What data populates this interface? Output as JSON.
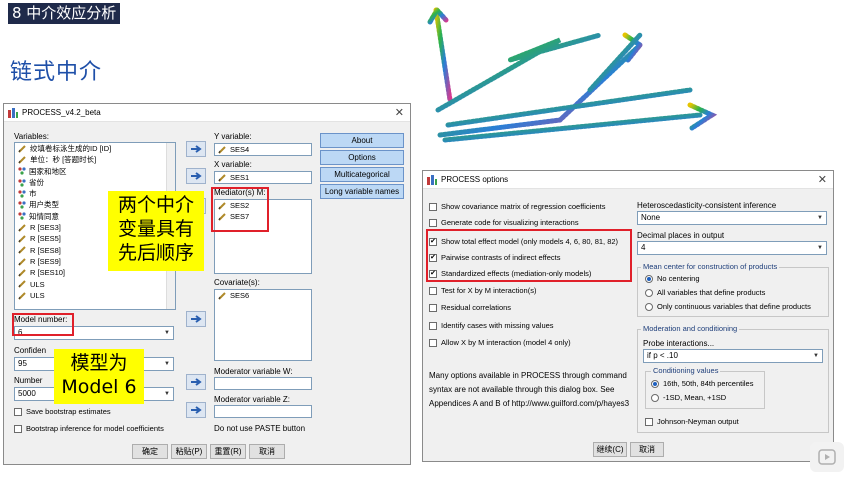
{
  "slide": {
    "tag": "8 中介效应分析",
    "title": "链式中介"
  },
  "process_dialog": {
    "title": "PROCESS_v4.2_beta",
    "variables_label": "Variables:",
    "variables": [
      {
        "name": "绞填卷标泳生成的ID [ID]",
        "type": "scale"
      },
      {
        "name": "单位：秒 [答题时长]",
        "type": "scale"
      },
      {
        "name": "国家和地区",
        "type": "nominal"
      },
      {
        "name": "省份",
        "type": "nominal"
      },
      {
        "name": "市",
        "type": "nominal"
      },
      {
        "name": "用户类型",
        "type": "nominal"
      },
      {
        "name": "知情同意",
        "type": "nominal"
      },
      {
        "name": "R [SES3]",
        "type": "scale"
      },
      {
        "name": "R [SES5]",
        "type": "scale"
      },
      {
        "name": "R [SES8]",
        "type": "scale"
      },
      {
        "name": "R [SES9]",
        "type": "scale"
      },
      {
        "name": "R [SES10]",
        "type": "scale"
      },
      {
        "name": "ULS",
        "type": "scale"
      },
      {
        "name": "ULS",
        "type": "scale"
      }
    ],
    "y_label": "Y variable:",
    "y_value": "SES4",
    "x_label": "X variable:",
    "x_value": "SES1",
    "mediators_label": "Mediator(s) M:",
    "mediators": [
      "SES2",
      "SES7"
    ],
    "covariates_label": "Covariate(s):",
    "covariates": [
      "SES6"
    ],
    "mod_w_label": "Moderator variable W:",
    "mod_z_label": "Moderator variable Z:",
    "paste_note": "Do not use PASTE button",
    "model_label": "Model number:",
    "model_value": "6",
    "confidence_label": "Confiden",
    "confidence_value": "95",
    "number_label": "Number",
    "number_value": "5000",
    "save_bootstrap": "Save bootstrap estimates",
    "bootstrap_inference": "Bootstrap inference for model coefficients",
    "side_buttons": [
      "About",
      "Options",
      "Multicategorical",
      "Long variable names"
    ],
    "bottom_buttons": [
      "确定",
      "粘贴(P)",
      "重置(R)",
      "取消"
    ]
  },
  "options_dialog": {
    "title": "PROCESS options",
    "checkboxes": [
      {
        "label": "Show covariance matrix of regression coefficients",
        "checked": false
      },
      {
        "label": "Generate code for visualizing interactions",
        "checked": false
      },
      {
        "label": "Show total effect model (only models 4, 6, 80, 81, 82)",
        "checked": true
      },
      {
        "label": "Pairwise contrasts of indirect effects",
        "checked": true
      },
      {
        "label": "Standardized effects (mediation-only models)",
        "checked": true
      },
      {
        "label": "Test for X by M interaction(s)",
        "checked": false
      },
      {
        "label": "Residual correlations",
        "checked": false
      },
      {
        "label": "Identify cases with missing values",
        "checked": false
      },
      {
        "label": "Allow X by M interaction (model 4 only)",
        "checked": false
      }
    ],
    "note_lines": [
      "Many options available in PROCESS through command",
      "syntax are not available through this dialog box.  See",
      "Appendices A and B of http://www.guilford.com/p/hayes3"
    ],
    "hc_label": "Heteroscedasticity-consistent inference",
    "hc_value": "None",
    "decimal_label": "Decimal places in output",
    "decimal_value": "4",
    "mean_center_title": "Mean center for construction of products",
    "mean_center_options": [
      {
        "label": "No centering",
        "selected": true
      },
      {
        "label": "All variables that define products",
        "selected": false
      },
      {
        "label": "Only continuous variables that define products",
        "selected": false
      }
    ],
    "moderation_title": "Moderation and conditioning",
    "probe_label": "Probe interactions...",
    "probe_value": "if p < .10",
    "conditioning_title": "Conditioning values",
    "conditioning_options": [
      {
        "label": "16th, 50th, 84th percentiles",
        "selected": true
      },
      {
        "label": "-1SD, Mean, +1SD",
        "selected": false
      }
    ],
    "johnson_neyman": "Johnson-Neyman output",
    "bottom_buttons": [
      "继续(C)",
      "取消"
    ]
  },
  "callouts": {
    "mediators_note_lines": [
      "两个中介",
      "变量具有",
      "先后顺序"
    ],
    "model_note_lines": [
      "模型为",
      "Model 6"
    ]
  },
  "colors": {
    "slide_tag_bg": "#1f2a4a",
    "title_blue": "#1e4fa8",
    "highlight_red": "#e0202a",
    "callout_yellow": "#ffff00"
  }
}
